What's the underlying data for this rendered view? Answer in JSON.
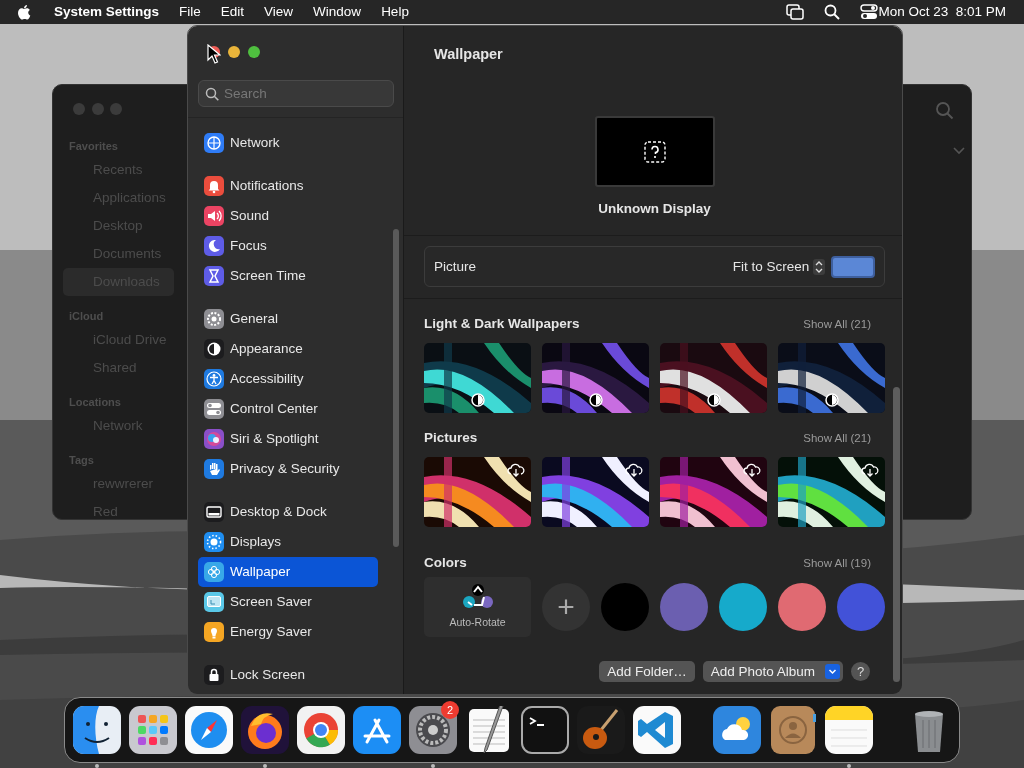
{
  "menu_bar": {
    "app_name": "System Settings",
    "menus": [
      "File",
      "Edit",
      "View",
      "Window",
      "Help"
    ],
    "clock": "Mon Oct 23  8:01 PM"
  },
  "finder": {
    "sections": [
      {
        "title": "Favorites",
        "items": [
          {
            "label": "Recents",
            "selected": false
          },
          {
            "label": "Applications",
            "selected": false
          },
          {
            "label": "Desktop",
            "selected": false
          },
          {
            "label": "Documents",
            "selected": false
          },
          {
            "label": "Downloads",
            "selected": true
          }
        ]
      },
      {
        "title": "iCloud",
        "items": [
          {
            "label": "iCloud Drive",
            "selected": false
          },
          {
            "label": "Shared",
            "selected": false
          }
        ]
      },
      {
        "title": "Locations",
        "items": [
          {
            "label": "Network",
            "selected": false
          }
        ]
      },
      {
        "title": "Tags",
        "items": [
          {
            "label": "rewwrerer",
            "selected": false
          },
          {
            "label": "Red",
            "selected": false
          }
        ]
      }
    ]
  },
  "settings": {
    "search": {
      "placeholder": "Search"
    },
    "sidebar": {
      "groups": [
        [
          {
            "label": "Network",
            "kind": "globe",
            "color": "#2f7cf6",
            "selected": false
          }
        ],
        [
          {
            "label": "Notifications",
            "kind": "bell",
            "color": "#eb4d3d",
            "selected": false
          },
          {
            "label": "Sound",
            "kind": "speaker",
            "color": "#eb4463",
            "selected": false
          },
          {
            "label": "Focus",
            "kind": "moon",
            "color": "#5e5ce6",
            "selected": false
          },
          {
            "label": "Screen Time",
            "kind": "hourglass",
            "color": "#5e5ce6",
            "selected": false
          }
        ],
        [
          {
            "label": "General",
            "kind": "gear",
            "color": "#8e8e93",
            "selected": false
          },
          {
            "label": "Appearance",
            "kind": "contrast",
            "color": "#1c1c1e",
            "selected": false
          },
          {
            "label": "Accessibility",
            "kind": "person",
            "color": "#1f7ae0",
            "selected": false
          },
          {
            "label": "Control Center",
            "kind": "toggles",
            "color": "#8e8e93",
            "selected": false
          },
          {
            "label": "Siri & Spotlight",
            "kind": "orb",
            "color": "#8a4fc8",
            "selected": false
          },
          {
            "label": "Privacy & Security",
            "kind": "hand",
            "color": "#1f7ae0",
            "selected": false
          }
        ],
        [
          {
            "label": "Desktop & Dock",
            "kind": "dock",
            "color": "#1c1c1e",
            "selected": false
          },
          {
            "label": "Displays",
            "kind": "sun",
            "color": "#1f8ef1",
            "selected": false
          },
          {
            "label": "Wallpaper",
            "kind": "flower",
            "color": "#38a8e8",
            "selected": true
          },
          {
            "label": "Screen Saver",
            "kind": "screen",
            "color": "#5ac8e8",
            "selected": false
          },
          {
            "label": "Energy Saver",
            "kind": "bulb",
            "color": "#f5a623",
            "selected": false
          }
        ],
        [
          {
            "label": "Lock Screen",
            "kind": "lock",
            "color": "#1c1c1e",
            "selected": false
          }
        ]
      ]
    },
    "title": "Wallpaper",
    "display": {
      "name": "Unknown Display"
    },
    "picture_row": {
      "label": "Picture",
      "mode": "Fit to Screen",
      "color": "#5b87d6"
    },
    "sections": [
      {
        "title": "Light & Dark Wallpapers",
        "show_all": "Show All (21)",
        "kind": "dynamic"
      },
      {
        "title": "Pictures",
        "show_all": "Show All (21)",
        "kind": "cloud"
      }
    ],
    "colors": {
      "title": "Colors",
      "show_all": "Show All (19)",
      "auto_rotate": "Auto-Rotate",
      "add": "+",
      "swatches": [
        {
          "color": "#000000"
        },
        {
          "color": "#6b5fb0"
        },
        {
          "color": "#16aacb"
        },
        {
          "color": "#e06a72"
        },
        {
          "color": "#4252d8"
        }
      ]
    },
    "buttons": {
      "add_folder": "Add Folder…",
      "add_album": "Add Photo Album",
      "help": "?"
    }
  },
  "dock": {
    "groups": [
      [
        {
          "kind": "finder",
          "running": true
        },
        {
          "kind": "launchpad",
          "running": false
        },
        {
          "kind": "safari",
          "running": false
        },
        {
          "kind": "firefox",
          "running": true
        },
        {
          "kind": "chrome",
          "running": false
        },
        {
          "kind": "appstore",
          "running": false
        },
        {
          "kind": "settings",
          "running": true,
          "badge": "2"
        },
        {
          "kind": "textedit",
          "running": false
        },
        {
          "kind": "terminal",
          "running": false
        },
        {
          "kind": "guitar",
          "running": false
        },
        {
          "kind": "code",
          "running": false
        }
      ],
      [
        {
          "kind": "weather",
          "running": false
        },
        {
          "kind": "contacts",
          "running": false
        },
        {
          "kind": "notes",
          "running": true
        }
      ],
      [
        {
          "kind": "trash",
          "running": false
        }
      ]
    ]
  }
}
